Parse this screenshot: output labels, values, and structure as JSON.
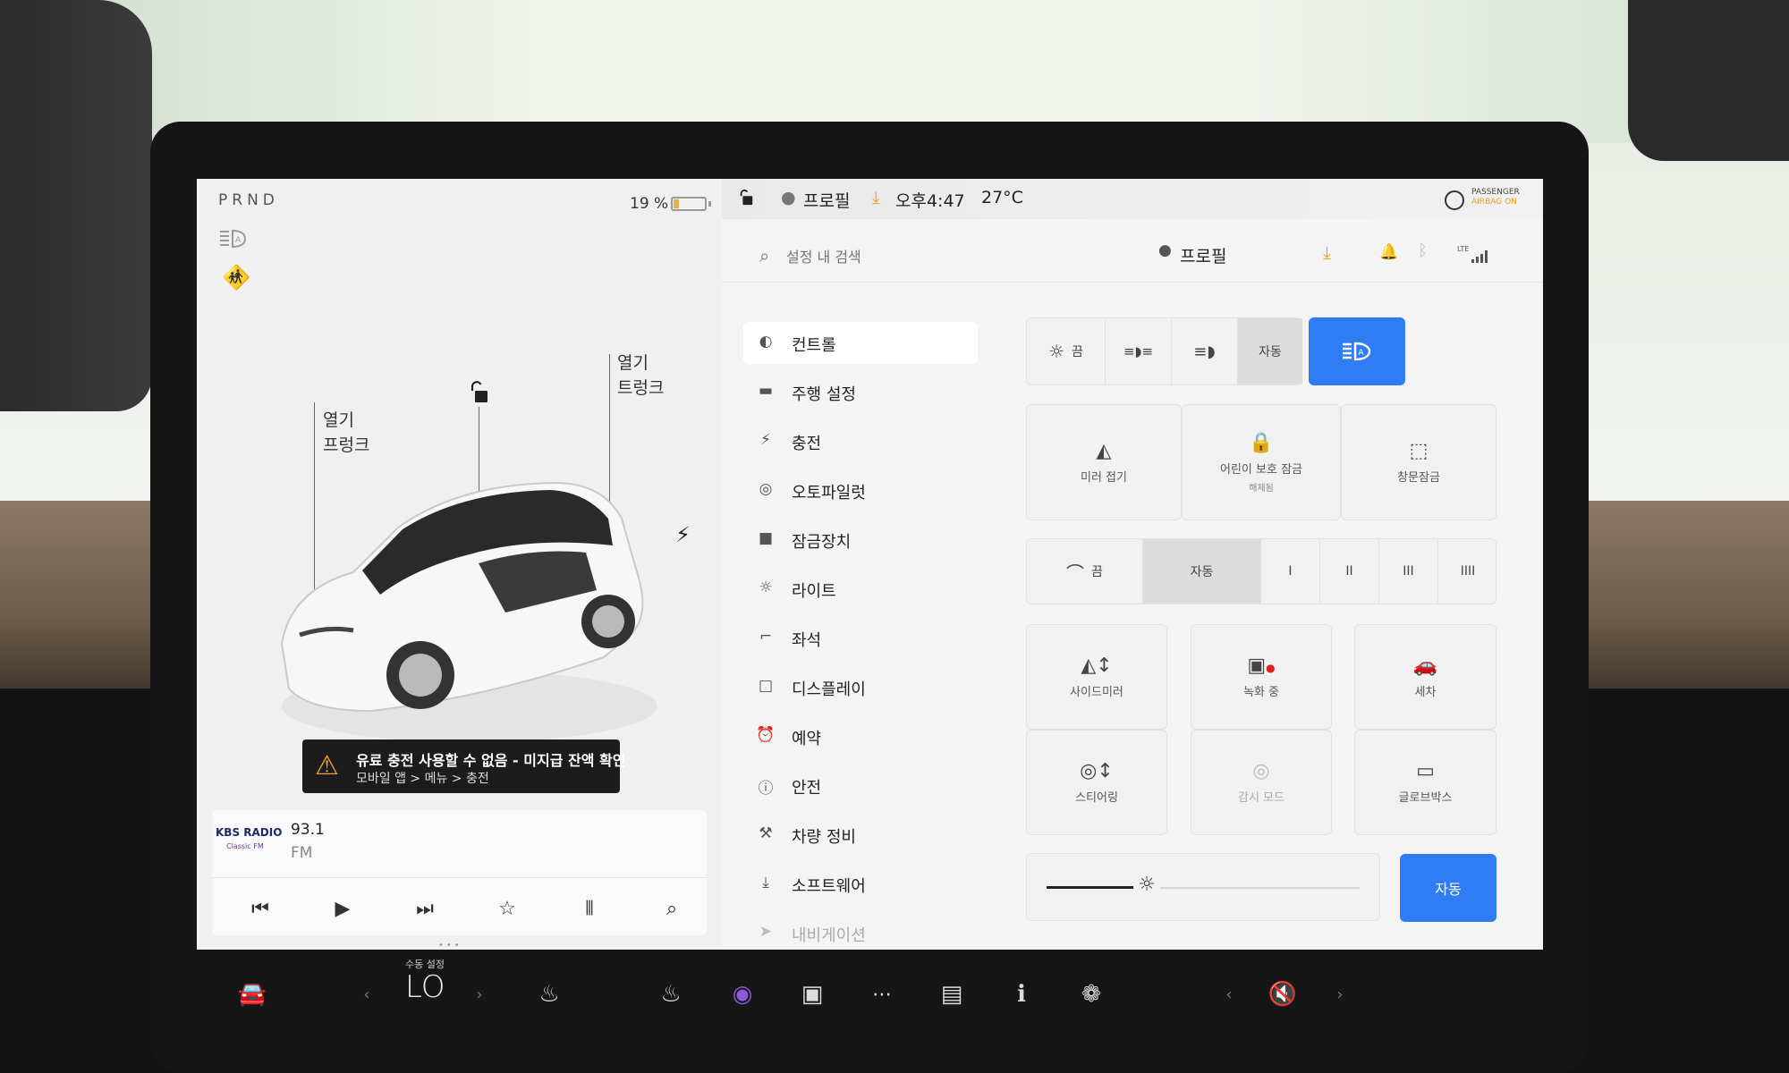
{
  "status": {
    "gear": "PRND",
    "battery_percent": "19 %",
    "battery_level": 0.19
  },
  "car": {
    "frunk_action": "열기",
    "frunk_label": "프렁크",
    "trunk_action": "열기",
    "trunk_label": "트렁크"
  },
  "warning": {
    "title": "유료 충전 사용할 수 없음 - 미지급 잔액 확인",
    "subtitle": "모바일 앱 > 메뉴 > 충전"
  },
  "media": {
    "station_logo": "KBS RADIO",
    "station_logo_sub": "Classic FM",
    "frequency": "93.1",
    "band": "FM"
  },
  "topbar": {
    "profile": "프로필",
    "time": "오후4:47",
    "temperature": "27°C",
    "airbag_line1": "PASSENGER",
    "airbag_line2": "AIRBAG ON"
  },
  "search": {
    "placeholder": "설정 내 검색",
    "profile": "프로필",
    "lte": "LTE"
  },
  "menu": {
    "items": [
      {
        "label": "컨트롤",
        "icon": "toggle-icon"
      },
      {
        "label": "주행 설정",
        "icon": "car-icon"
      },
      {
        "label": "충전",
        "icon": "bolt-icon"
      },
      {
        "label": "오토파일럿",
        "icon": "steering-wheel-icon"
      },
      {
        "label": "잠금장치",
        "icon": "lock-icon"
      },
      {
        "label": "라이트",
        "icon": "sun-icon"
      },
      {
        "label": "좌석",
        "icon": "seat-icon"
      },
      {
        "label": "디스플레이",
        "icon": "display-icon"
      },
      {
        "label": "예약",
        "icon": "alarm-icon"
      },
      {
        "label": "안전",
        "icon": "info-icon"
      },
      {
        "label": "차량 정비",
        "icon": "wrench-icon"
      },
      {
        "label": "소프트웨어",
        "icon": "download-icon"
      },
      {
        "label": "내비게이션",
        "icon": "navigation-icon"
      }
    ]
  },
  "lights": {
    "off": "끔",
    "auto": "자동"
  },
  "access": {
    "mirror_fold": "미러 접기",
    "child_lock": "어린이 보호 잠금",
    "child_lock_sub": "해제됨",
    "window_lock": "창문잠금"
  },
  "wipers": {
    "off": "끔",
    "auto": "자동",
    "speeds": [
      "I",
      "II",
      "III",
      "IIII"
    ]
  },
  "quick": {
    "side_mirror": "사이드미러",
    "recording": "녹화 중",
    "car_wash": "세차",
    "steering": "스티어링",
    "sentry": "감시 모드",
    "glovebox": "글로브박스"
  },
  "brightness": {
    "auto": "자동",
    "level": 0.32
  },
  "dock": {
    "climate_label": "수동 설정",
    "climate_value": "LO"
  },
  "colors": {
    "accent": "#2f7cf5",
    "warning": "#f0a030",
    "download": "#e8a020",
    "seatbelt": "#d64040"
  }
}
